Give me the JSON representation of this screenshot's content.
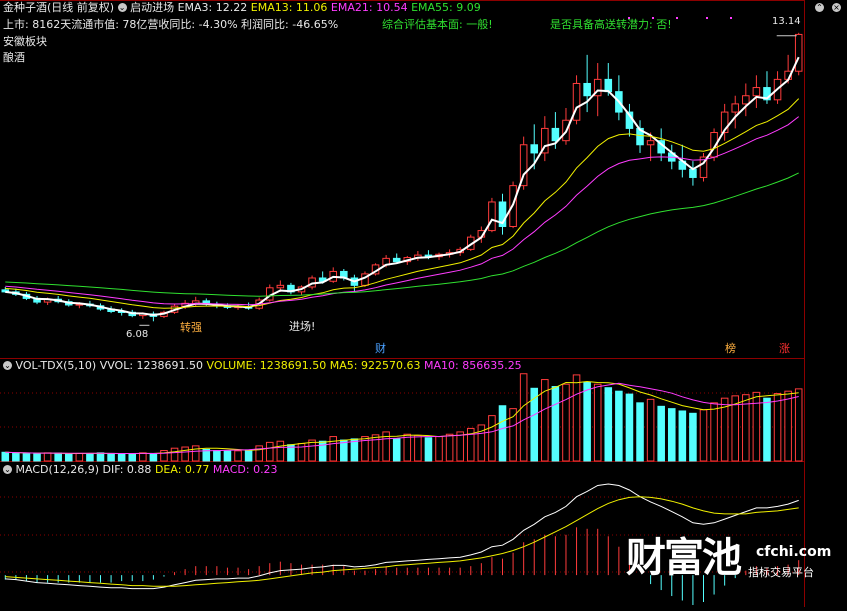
{
  "header": {
    "stock_name": "金种子酒",
    "period": "(日线 前复权)",
    "indicator_name": "启动进场",
    "ema3": "EMA3: 12.22",
    "ema13": "EMA13: 11.06",
    "ema21": "EMA21: 10.54",
    "ema55": "EMA55: 9.09",
    "info_listing": "上市: 8162天",
    "info_mktcap": "流通市值: 78亿",
    "info_rev": "营收同比: -4.30%",
    "info_profit": "利润同比: -46.65%",
    "eval": "综合评估基本面: 一般!",
    "bonus": "是否具备高送转潜力: 否!",
    "sector": "安徽板块",
    "industry": "酿酒"
  },
  "price_annotations": {
    "high": "13.14",
    "low": "6.08",
    "signal_strong": "转强",
    "signal_entry": "进场!",
    "badge_cai": "财",
    "badge_bang": "榜",
    "badge_zhang": "涨"
  },
  "volume_header": {
    "name": "VOL-TDX(5,10)",
    "vvol": "VVOL: 1238691.50",
    "volume": "VOLUME: 1238691.50",
    "ma5": "MA5: 922570.63",
    "ma10": "MA10: 856635.25"
  },
  "macd_header": {
    "name": "MACD(12,26,9)",
    "dif": "DIF: 0.88",
    "dea": "DEA: 0.77",
    "macd": "MACD: 0.23"
  },
  "watermark": {
    "brand": "财富池",
    "site": "cfchi.com",
    "tagline": "指标交易平台"
  },
  "colors": {
    "up": "#ff3c3c",
    "down": "#54ffff",
    "ema3": "#ffffff",
    "ema13": "#f0f000",
    "ema21": "#ff3cff",
    "ema55": "#30e030",
    "grid": "#8c0000"
  },
  "chart_data": {
    "type": "candlestick",
    "price_ylim": [
      5.5,
      13.6
    ],
    "candles": [
      [
        6.85,
        6.92,
        6.78,
        6.8
      ],
      [
        6.8,
        6.88,
        6.7,
        6.74
      ],
      [
        6.74,
        6.8,
        6.6,
        6.64
      ],
      [
        6.64,
        6.7,
        6.5,
        6.55
      ],
      [
        6.55,
        6.66,
        6.48,
        6.62
      ],
      [
        6.62,
        6.7,
        6.52,
        6.56
      ],
      [
        6.56,
        6.62,
        6.44,
        6.48
      ],
      [
        6.48,
        6.55,
        6.4,
        6.5
      ],
      [
        6.5,
        6.58,
        6.42,
        6.46
      ],
      [
        6.46,
        6.52,
        6.34,
        6.38
      ],
      [
        6.38,
        6.45,
        6.28,
        6.32
      ],
      [
        6.32,
        6.4,
        6.22,
        6.3
      ],
      [
        6.3,
        6.36,
        6.18,
        6.22
      ],
      [
        6.22,
        6.3,
        6.14,
        6.26
      ],
      [
        6.26,
        6.32,
        6.08,
        6.2
      ],
      [
        6.2,
        6.34,
        6.16,
        6.3
      ],
      [
        6.3,
        6.5,
        6.26,
        6.45
      ],
      [
        6.45,
        6.6,
        6.38,
        6.52
      ],
      [
        6.52,
        6.68,
        6.44,
        6.58
      ],
      [
        6.58,
        6.64,
        6.46,
        6.5
      ],
      [
        6.5,
        6.56,
        6.4,
        6.46
      ],
      [
        6.46,
        6.52,
        6.38,
        6.42
      ],
      [
        6.42,
        6.5,
        6.36,
        6.44
      ],
      [
        6.44,
        6.54,
        6.36,
        6.4
      ],
      [
        6.4,
        6.66,
        6.36,
        6.6
      ],
      [
        6.6,
        6.98,
        6.56,
        6.9
      ],
      [
        6.9,
        7.08,
        6.8,
        6.96
      ],
      [
        6.96,
        7.02,
        6.74,
        6.8
      ],
      [
        6.8,
        6.96,
        6.72,
        6.92
      ],
      [
        6.92,
        7.2,
        6.86,
        7.14
      ],
      [
        7.14,
        7.3,
        7.0,
        7.06
      ],
      [
        7.06,
        7.4,
        7.02,
        7.3
      ],
      [
        7.3,
        7.36,
        7.08,
        7.14
      ],
      [
        7.14,
        7.22,
        6.8,
        6.96
      ],
      [
        6.96,
        7.3,
        6.92,
        7.24
      ],
      [
        7.24,
        7.5,
        7.2,
        7.46
      ],
      [
        7.46,
        7.7,
        7.4,
        7.62
      ],
      [
        7.62,
        7.74,
        7.5,
        7.54
      ],
      [
        7.54,
        7.68,
        7.46,
        7.64
      ],
      [
        7.64,
        7.8,
        7.56,
        7.7
      ],
      [
        7.7,
        7.82,
        7.6,
        7.66
      ],
      [
        7.66,
        7.76,
        7.58,
        7.72
      ],
      [
        7.72,
        7.84,
        7.64,
        7.76
      ],
      [
        7.76,
        7.9,
        7.68,
        7.84
      ],
      [
        7.84,
        8.2,
        7.8,
        8.14
      ],
      [
        8.14,
        8.4,
        8.0,
        8.3
      ],
      [
        8.3,
        9.1,
        8.26,
        9.0
      ],
      [
        9.0,
        9.2,
        8.2,
        8.4
      ],
      [
        8.4,
        9.5,
        8.36,
        9.4
      ],
      [
        9.4,
        10.6,
        9.3,
        10.4
      ],
      [
        10.4,
        10.9,
        9.8,
        10.2
      ],
      [
        10.2,
        11.1,
        10.0,
        10.8
      ],
      [
        10.8,
        11.2,
        10.3,
        10.5
      ],
      [
        10.5,
        11.3,
        10.4,
        11.0
      ],
      [
        11.0,
        12.1,
        10.9,
        11.9
      ],
      [
        11.9,
        12.6,
        11.2,
        11.6
      ],
      [
        11.6,
        12.4,
        11.1,
        12.0
      ],
      [
        12.0,
        12.4,
        11.6,
        11.7
      ],
      [
        11.7,
        12.1,
        11.0,
        11.2
      ],
      [
        11.2,
        11.4,
        10.6,
        10.8
      ],
      [
        10.8,
        11.0,
        10.2,
        10.4
      ],
      [
        10.4,
        10.7,
        10.0,
        10.5
      ],
      [
        10.5,
        10.8,
        10.0,
        10.2
      ],
      [
        10.2,
        10.4,
        9.8,
        10.0
      ],
      [
        10.0,
        10.4,
        9.6,
        9.8
      ],
      [
        9.8,
        10.0,
        9.4,
        9.6
      ],
      [
        9.6,
        10.2,
        9.5,
        10.1
      ],
      [
        10.1,
        10.8,
        10.0,
        10.7
      ],
      [
        10.7,
        11.4,
        10.5,
        11.2
      ],
      [
        11.2,
        11.6,
        10.8,
        11.4
      ],
      [
        11.4,
        11.9,
        11.1,
        11.6
      ],
      [
        11.6,
        12.1,
        11.3,
        11.8
      ],
      [
        11.8,
        12.2,
        11.4,
        11.5
      ],
      [
        11.5,
        12.2,
        11.4,
        12.0
      ],
      [
        12.0,
        12.6,
        11.9,
        12.2
      ],
      [
        12.2,
        13.14,
        12.1,
        13.1
      ]
    ],
    "volume": [
      150,
      140,
      130,
      120,
      140,
      135,
      120,
      130,
      125,
      140,
      130,
      120,
      125,
      140,
      130,
      180,
      220,
      240,
      260,
      200,
      180,
      170,
      175,
      190,
      260,
      320,
      340,
      280,
      300,
      360,
      340,
      420,
      360,
      380,
      420,
      450,
      500,
      380,
      460,
      440,
      400,
      420,
      460,
      500,
      560,
      620,
      780,
      950,
      900,
      1500,
      1250,
      1400,
      1280,
      1320,
      1480,
      1350,
      1320,
      1260,
      1200,
      1150,
      1000,
      1060,
      940,
      900,
      860,
      820,
      880,
      1000,
      1080,
      1120,
      1140,
      1180,
      1080,
      1160,
      1200,
      1240
    ],
    "macd": {
      "dif": [
        -0.05,
        -0.06,
        -0.08,
        -0.1,
        -0.11,
        -0.12,
        -0.13,
        -0.14,
        -0.15,
        -0.16,
        -0.17,
        -0.17,
        -0.18,
        -0.18,
        -0.18,
        -0.16,
        -0.13,
        -0.1,
        -0.07,
        -0.06,
        -0.05,
        -0.05,
        -0.04,
        -0.04,
        -0.01,
        0.03,
        0.06,
        0.07,
        0.08,
        0.1,
        0.11,
        0.13,
        0.13,
        0.11,
        0.12,
        0.14,
        0.17,
        0.18,
        0.19,
        0.2,
        0.21,
        0.22,
        0.23,
        0.24,
        0.27,
        0.31,
        0.38,
        0.4,
        0.48,
        0.6,
        0.68,
        0.78,
        0.84,
        0.92,
        1.05,
        1.12,
        1.2,
        1.22,
        1.2,
        1.14,
        1.05,
        0.98,
        0.92,
        0.85,
        0.78,
        0.7,
        0.68,
        0.7,
        0.75,
        0.8,
        0.85,
        0.9,
        0.9,
        0.92,
        0.95,
        1.0
      ],
      "dea": [
        -0.02,
        -0.03,
        -0.04,
        -0.05,
        -0.06,
        -0.07,
        -0.08,
        -0.09,
        -0.1,
        -0.11,
        -0.12,
        -0.13,
        -0.14,
        -0.14,
        -0.15,
        -0.15,
        -0.15,
        -0.14,
        -0.13,
        -0.12,
        -0.11,
        -0.1,
        -0.09,
        -0.08,
        -0.07,
        -0.05,
        -0.03,
        -0.01,
        0.01,
        0.03,
        0.04,
        0.06,
        0.07,
        0.08,
        0.09,
        0.1,
        0.11,
        0.13,
        0.14,
        0.15,
        0.16,
        0.17,
        0.18,
        0.19,
        0.21,
        0.23,
        0.26,
        0.29,
        0.33,
        0.38,
        0.44,
        0.51,
        0.58,
        0.65,
        0.73,
        0.81,
        0.89,
        0.96,
        1.01,
        1.04,
        1.05,
        1.04,
        1.02,
        0.99,
        0.95,
        0.9,
        0.86,
        0.83,
        0.82,
        0.82,
        0.82,
        0.84,
        0.85,
        0.86,
        0.88,
        0.9
      ]
    }
  }
}
